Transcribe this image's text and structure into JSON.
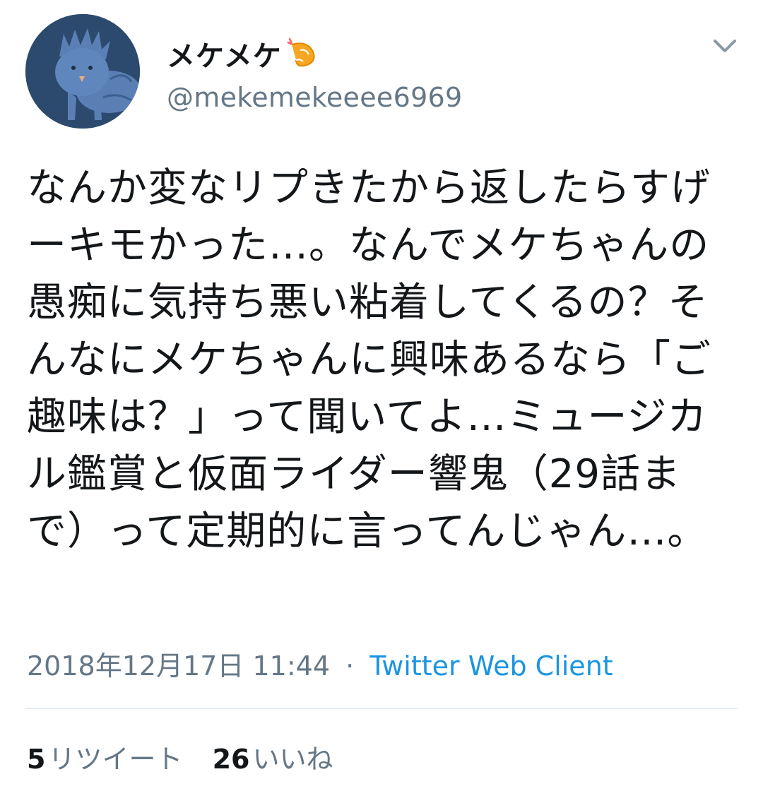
{
  "author": {
    "display_name": "メケメケ",
    "emoji_icon": "shrimp-icon",
    "handle": "@mekemekeeee6969"
  },
  "tweet": {
    "text": "なんか変なリプきたから返したらすげーキモかった…。なんでメケちゃんの愚痴に気持ち悪い粘着してくるの？そんなにメケちゃんに興味あるなら「ご趣味は？」って聞いてよ…ミュージカル鑑賞と仮面ライダー響鬼（29話まで）って定期的に言ってんじゃん…。"
  },
  "meta": {
    "timestamp": "2018年12月17日 11:44",
    "separator": "·",
    "source": "Twitter Web Client"
  },
  "stats": {
    "retweets_count": "5",
    "retweets_label": "リツイート",
    "likes_count": "26",
    "likes_label": "いいね"
  },
  "colors": {
    "text": "#14171a",
    "secondary": "#657786",
    "link": "#1b95e0",
    "divider": "#e6ecf0"
  }
}
